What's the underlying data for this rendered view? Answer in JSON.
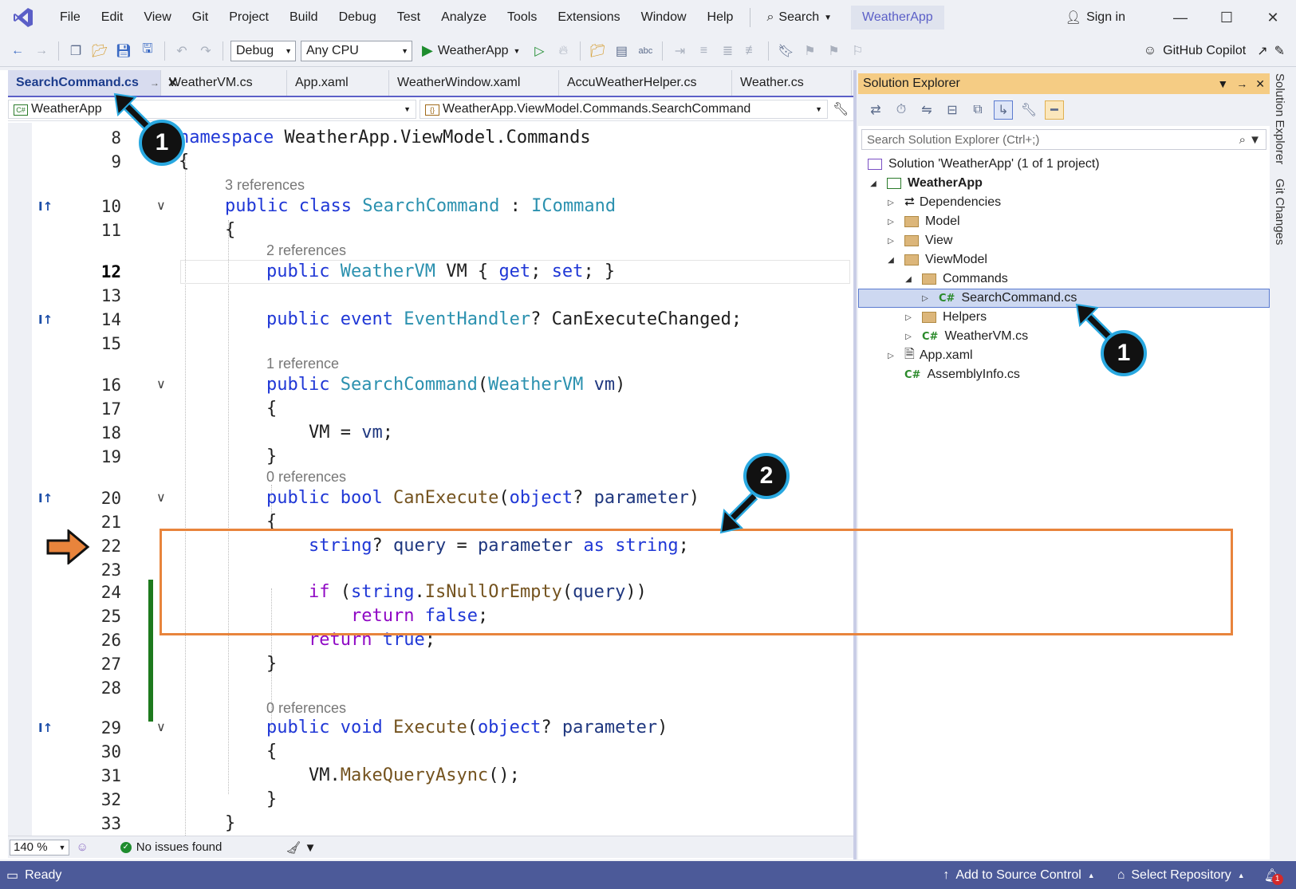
{
  "menu": {
    "items": [
      "File",
      "Edit",
      "View",
      "Git",
      "Project",
      "Build",
      "Debug",
      "Test",
      "Analyze",
      "Tools",
      "Extensions",
      "Window",
      "Help"
    ],
    "search_label": "Search",
    "app_title": "WeatherApp",
    "sign_in": "Sign in"
  },
  "toolbar": {
    "config": "Debug",
    "platform": "Any CPU",
    "run_target": "WeatherApp",
    "copilot": "GitHub Copilot"
  },
  "editor": {
    "tabs": [
      "SearchCommand.cs",
      "WeatherVM.cs",
      "App.xaml",
      "WeatherWindow.xaml",
      "AccuWeatherHelper.cs",
      "Weather.cs"
    ],
    "nav_project": "WeatherApp",
    "nav_member": "WeatherApp.ViewModel.Commands.SearchCommand",
    "zoom": "140 %",
    "issues": "No issues found",
    "lines": {
      "l8": "namespace WeatherApp.ViewModel.Commands",
      "refs10": "3 references",
      "refs12": "2 references",
      "refs16": "1 reference",
      "refs20": "0 references",
      "refs29": "0 references"
    }
  },
  "solution_explorer": {
    "title": "Solution Explorer",
    "search_placeholder": "Search Solution Explorer (Ctrl+;)",
    "solution": "Solution 'WeatherApp' (1 of 1 project)",
    "project": "WeatherApp",
    "items": {
      "dependencies": "Dependencies",
      "model": "Model",
      "view": "View",
      "viewmodel": "ViewModel",
      "commands": "Commands",
      "searchcommand": "SearchCommand.cs",
      "helpers": "Helpers",
      "weathervm": "WeatherVM.cs",
      "appxaml": "App.xaml",
      "assemblyinfo": "AssemblyInfo.cs"
    },
    "side_tabs": [
      "Solution Explorer",
      "Git Changes"
    ]
  },
  "statusbar": {
    "ready": "Ready",
    "add_source": "Add to Source Control",
    "select_repo": "Select Repository",
    "notif_count": "1"
  },
  "callouts": {
    "one": "1",
    "two": "2"
  },
  "colors": {
    "accent": "#5b5fc7",
    "highlight": "#e8843c",
    "callout_ring": "#29a8e0",
    "statusbar": "#4c5a99"
  }
}
